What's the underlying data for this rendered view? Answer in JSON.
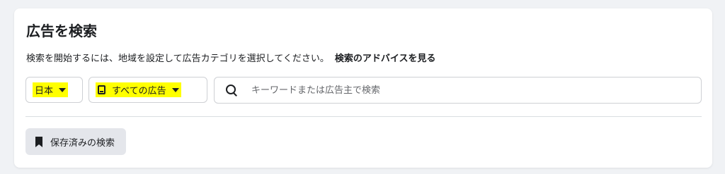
{
  "header": {
    "title": "広告を検索"
  },
  "description": {
    "text": "検索を開始するには、地域を設定して広告カテゴリを選択してください。",
    "advice_link": "検索のアドバイスを見る"
  },
  "filters": {
    "country": {
      "selected": "日本",
      "icon": "chevron-down-icon"
    },
    "category": {
      "selected": "すべての広告",
      "icon": "ad-icon"
    }
  },
  "search": {
    "placeholder": "キーワードまたは広告主で検索",
    "value": "",
    "icon": "search-icon"
  },
  "saved_searches": {
    "label": "保存済みの検索",
    "icon": "bookmark-icon"
  },
  "colors": {
    "highlight": "#ffff00",
    "text": "#1c1e21",
    "border": "#ced0d4",
    "button_bg": "#e4e6eb"
  }
}
